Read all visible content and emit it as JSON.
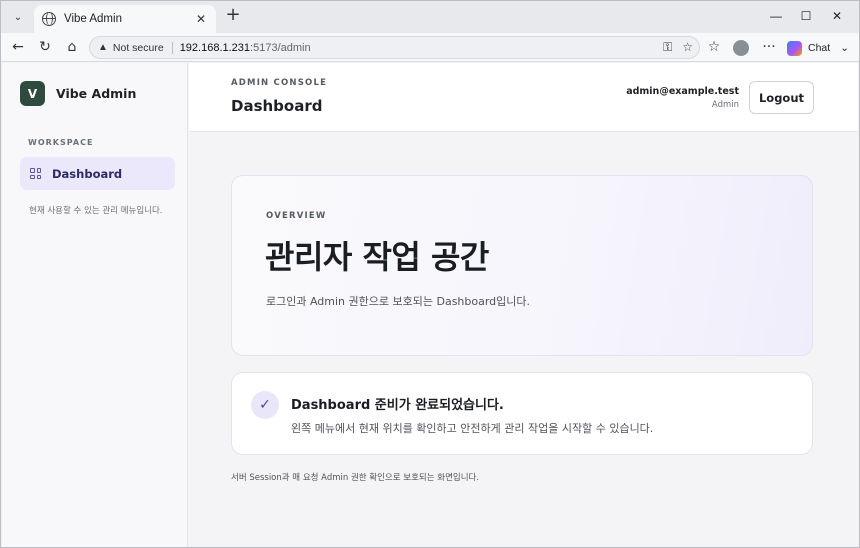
{
  "browser": {
    "tab_title": "Vibe Admin",
    "not_secure": "Not secure",
    "url_host": "192.168.1.231",
    "url_rest": ":5173/admin",
    "chat_label": "Chat"
  },
  "sidebar": {
    "brand_initial": "V",
    "brand_name": "Vibe Admin",
    "section_label": "WORKSPACE",
    "items": [
      {
        "label": "Dashboard",
        "active": true
      }
    ],
    "note": "현재 사용할 수 있는 관리 메뉴입니다."
  },
  "header": {
    "eyebrow": "ADMIN CONSOLE",
    "title": "Dashboard",
    "user_email": "admin@example.test",
    "user_role": "Admin",
    "logout_label": "Logout"
  },
  "overview": {
    "label": "OVERVIEW",
    "title": "관리자 작업 공간",
    "description": "로그인과 Admin 권한으로 보호되는 Dashboard입니다."
  },
  "status": {
    "icon": "✓",
    "title": "Dashboard 준비가 완료되었습니다.",
    "description": "왼쪽 메뉴에서 현재 위치를 확인하고 안전하게 관리 작업을 시작할 수 있습니다."
  },
  "footnote": "서버 Session과 매 요청 Admin 권한 확인으로 보호되는 화면입니다.",
  "colors": {
    "accent": "#5b56a8",
    "brand": "#2f4a3f",
    "nav_active_bg": "#ebe8fb"
  }
}
